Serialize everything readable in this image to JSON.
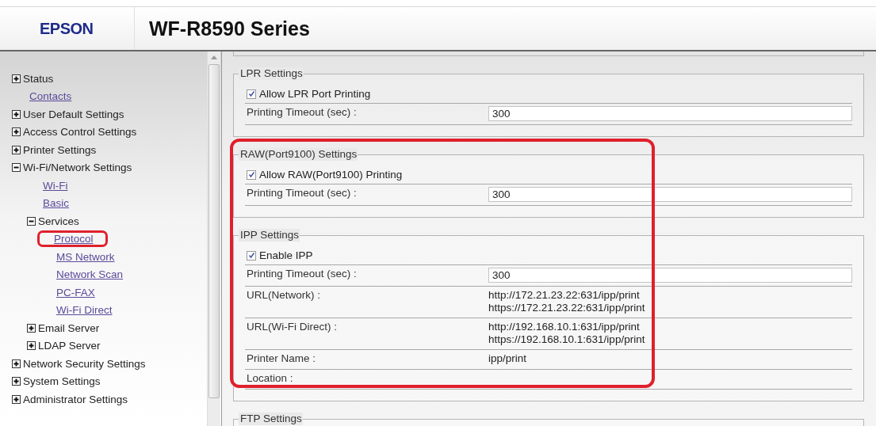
{
  "header": {
    "logo": "EPSON",
    "title": "WF-R8590 Series"
  },
  "sidebar": {
    "items": [
      {
        "kind": "group",
        "label": "Status",
        "expanded": false
      },
      {
        "kind": "link",
        "label": "Contacts",
        "highlighted": false
      },
      {
        "kind": "group",
        "label": "User Default Settings",
        "expanded": false
      },
      {
        "kind": "group",
        "label": "Access Control Settings",
        "expanded": false
      },
      {
        "kind": "group",
        "label": "Printer Settings",
        "expanded": false
      },
      {
        "kind": "group",
        "label": "Wi-Fi/Network Settings",
        "expanded": true,
        "children": [
          {
            "kind": "link",
            "label": "Wi-Fi",
            "highlighted": false
          },
          {
            "kind": "link",
            "label": "Basic",
            "highlighted": false
          },
          {
            "kind": "group",
            "label": "Services",
            "expanded": true,
            "children": [
              {
                "kind": "link",
                "label": "Protocol",
                "highlighted": true
              },
              {
                "kind": "link",
                "label": "MS Network",
                "highlighted": false
              },
              {
                "kind": "link",
                "label": "Network Scan",
                "highlighted": false
              },
              {
                "kind": "link",
                "label": "PC-FAX",
                "highlighted": false
              },
              {
                "kind": "link",
                "label": "Wi-Fi Direct",
                "highlighted": false
              }
            ]
          },
          {
            "kind": "group",
            "label": "Email Server",
            "expanded": false
          },
          {
            "kind": "group",
            "label": "LDAP Server",
            "expanded": false
          }
        ]
      },
      {
        "kind": "group",
        "label": "Network Security Settings",
        "expanded": false
      },
      {
        "kind": "group",
        "label": "System Settings",
        "expanded": false
      },
      {
        "kind": "group",
        "label": "Administrator Settings",
        "expanded": false
      }
    ]
  },
  "content": {
    "sections": [
      {
        "title": "LPR Settings",
        "highlighted": false,
        "rows": [
          {
            "kind": "checkbox",
            "label": "Allow LPR Port Printing",
            "checked": true
          },
          {
            "kind": "input",
            "label": "Printing Timeout (sec) :",
            "value": "300"
          }
        ]
      },
      {
        "title": "RAW(Port9100) Settings",
        "highlighted": true,
        "rows": [
          {
            "kind": "checkbox",
            "label": "Allow RAW(Port9100) Printing",
            "checked": true
          },
          {
            "kind": "input",
            "label": "Printing Timeout (sec) :",
            "value": "300"
          }
        ]
      },
      {
        "title": "IPP Settings",
        "highlighted": true,
        "rows": [
          {
            "kind": "checkbox",
            "label": "Enable IPP",
            "checked": true
          },
          {
            "kind": "input",
            "label": "Printing Timeout (sec) :",
            "value": "300"
          },
          {
            "kind": "text",
            "label": "URL(Network) :",
            "lines": [
              "http://172.21.23.22:631/ipp/print",
              "https://172.21.23.22:631/ipp/print"
            ]
          },
          {
            "kind": "text",
            "label": "URL(Wi-Fi Direct) :",
            "lines": [
              "http://192.168.10.1:631/ipp/print",
              "https://192.168.10.1:631/ipp/print"
            ]
          },
          {
            "kind": "text",
            "label": "Printer Name :",
            "lines": [
              "ipp/print"
            ]
          },
          {
            "kind": "text",
            "label": "Location :"
          }
        ]
      },
      {
        "title": "FTP Settings",
        "highlighted": false
      }
    ]
  }
}
